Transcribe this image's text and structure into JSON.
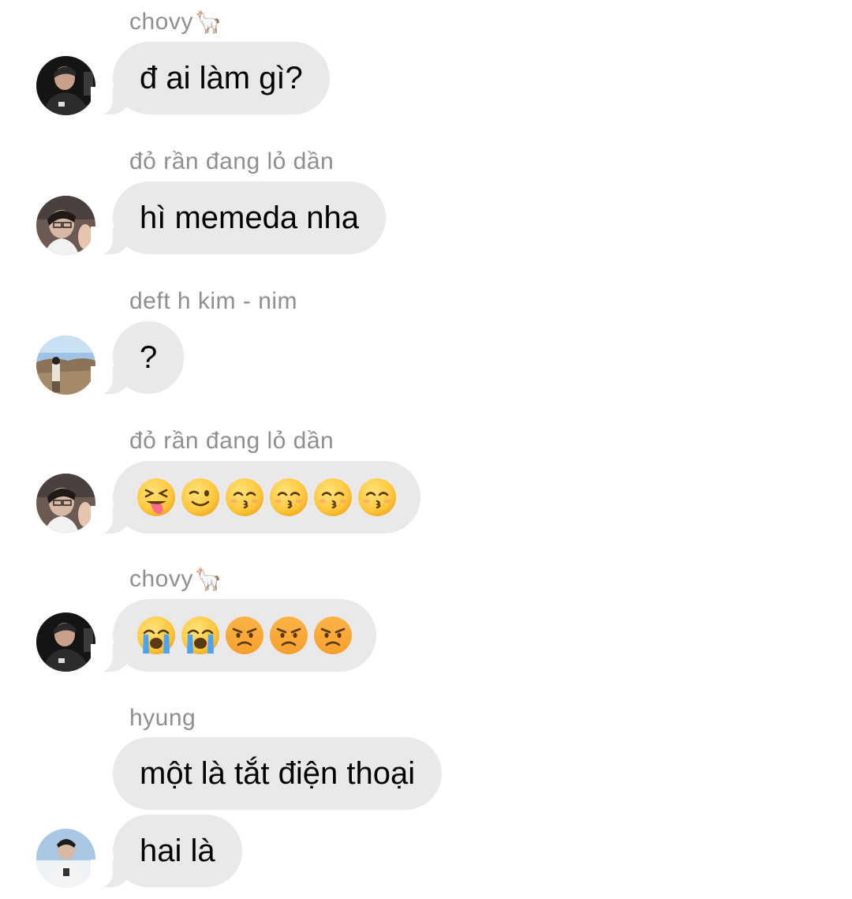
{
  "messages": [
    {
      "sender": "chovy",
      "sender_deco": "🦙",
      "avatar": "avatar-chovy",
      "text": "đ ai làm gì?"
    },
    {
      "sender": "đỏ rần đang lỏ dần",
      "avatar": "avatar-red",
      "text": "hì memeda nha"
    },
    {
      "sender": "deft h kim - nim",
      "avatar": "avatar-deft",
      "text": "?"
    },
    {
      "sender": "đỏ rần đang lỏ dần",
      "avatar": "avatar-red",
      "emojis": [
        "squinting-tongue-face",
        "winking-face",
        "kissing-smiling-eyes-face",
        "kissing-smiling-eyes-face",
        "kissing-smiling-eyes-face",
        "kissing-smiling-eyes-face"
      ]
    },
    {
      "sender": "chovy",
      "sender_deco": "🦙",
      "avatar": "avatar-chovy",
      "emojis": [
        "loudly-crying-face",
        "loudly-crying-face",
        "angry-face",
        "angry-face",
        "angry-face"
      ]
    },
    {
      "sender": "hyung",
      "avatar": "avatar-hyung",
      "texts": [
        "một là tắt điện thoại",
        "hai là"
      ]
    }
  ],
  "colors": {
    "bubble": "#e9e9eb",
    "sender_text": "#8e8e93",
    "emoji_yellow": "#ffcc33",
    "background": "#ffffff"
  }
}
